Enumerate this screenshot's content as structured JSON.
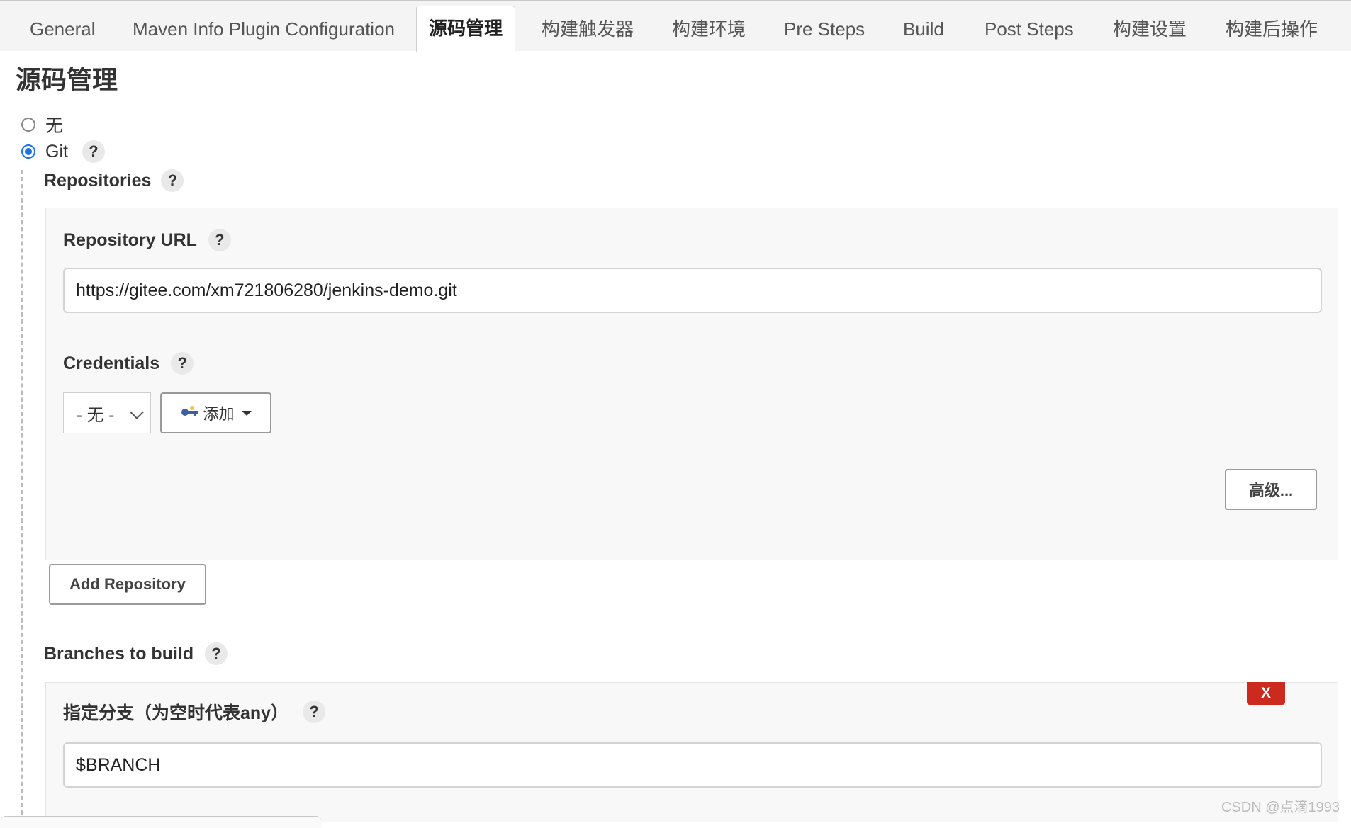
{
  "tabs": [
    {
      "label": "General"
    },
    {
      "label": "Maven Info Plugin Configuration"
    },
    {
      "label": "源码管理"
    },
    {
      "label": "构建触发器"
    },
    {
      "label": "构建环境"
    },
    {
      "label": "Pre Steps"
    },
    {
      "label": "Build"
    },
    {
      "label": "Post Steps"
    },
    {
      "label": "构建设置"
    },
    {
      "label": "构建后操作"
    }
  ],
  "active_tab": "源码管理",
  "scm": {
    "title": "源码管理",
    "options": {
      "none": "无",
      "git": "Git"
    },
    "selected": "Git",
    "help_glyph": "?",
    "repositories": {
      "label": "Repositories",
      "url_label": "Repository URL",
      "url_value": "https://gitee.com/xm721806280/jenkins-demo.git",
      "credentials_label": "Credentials",
      "credentials_selected": "- 无 -",
      "add_label": "添加",
      "advanced_label": "高级...",
      "add_repo_label": "Add Repository"
    },
    "branches": {
      "label": "Branches to build",
      "spec_label": "指定分支（为空时代表any）",
      "spec_value": "$BRANCH",
      "delete_label": "X"
    }
  },
  "watermark": "CSDN @点滴1993",
  "colors": {
    "accent": "#1a73e8",
    "danger": "#cc2a1f"
  },
  "icons": [
    "key-icon",
    "help-icon",
    "chevron-down-icon",
    "caret-down-icon"
  ]
}
